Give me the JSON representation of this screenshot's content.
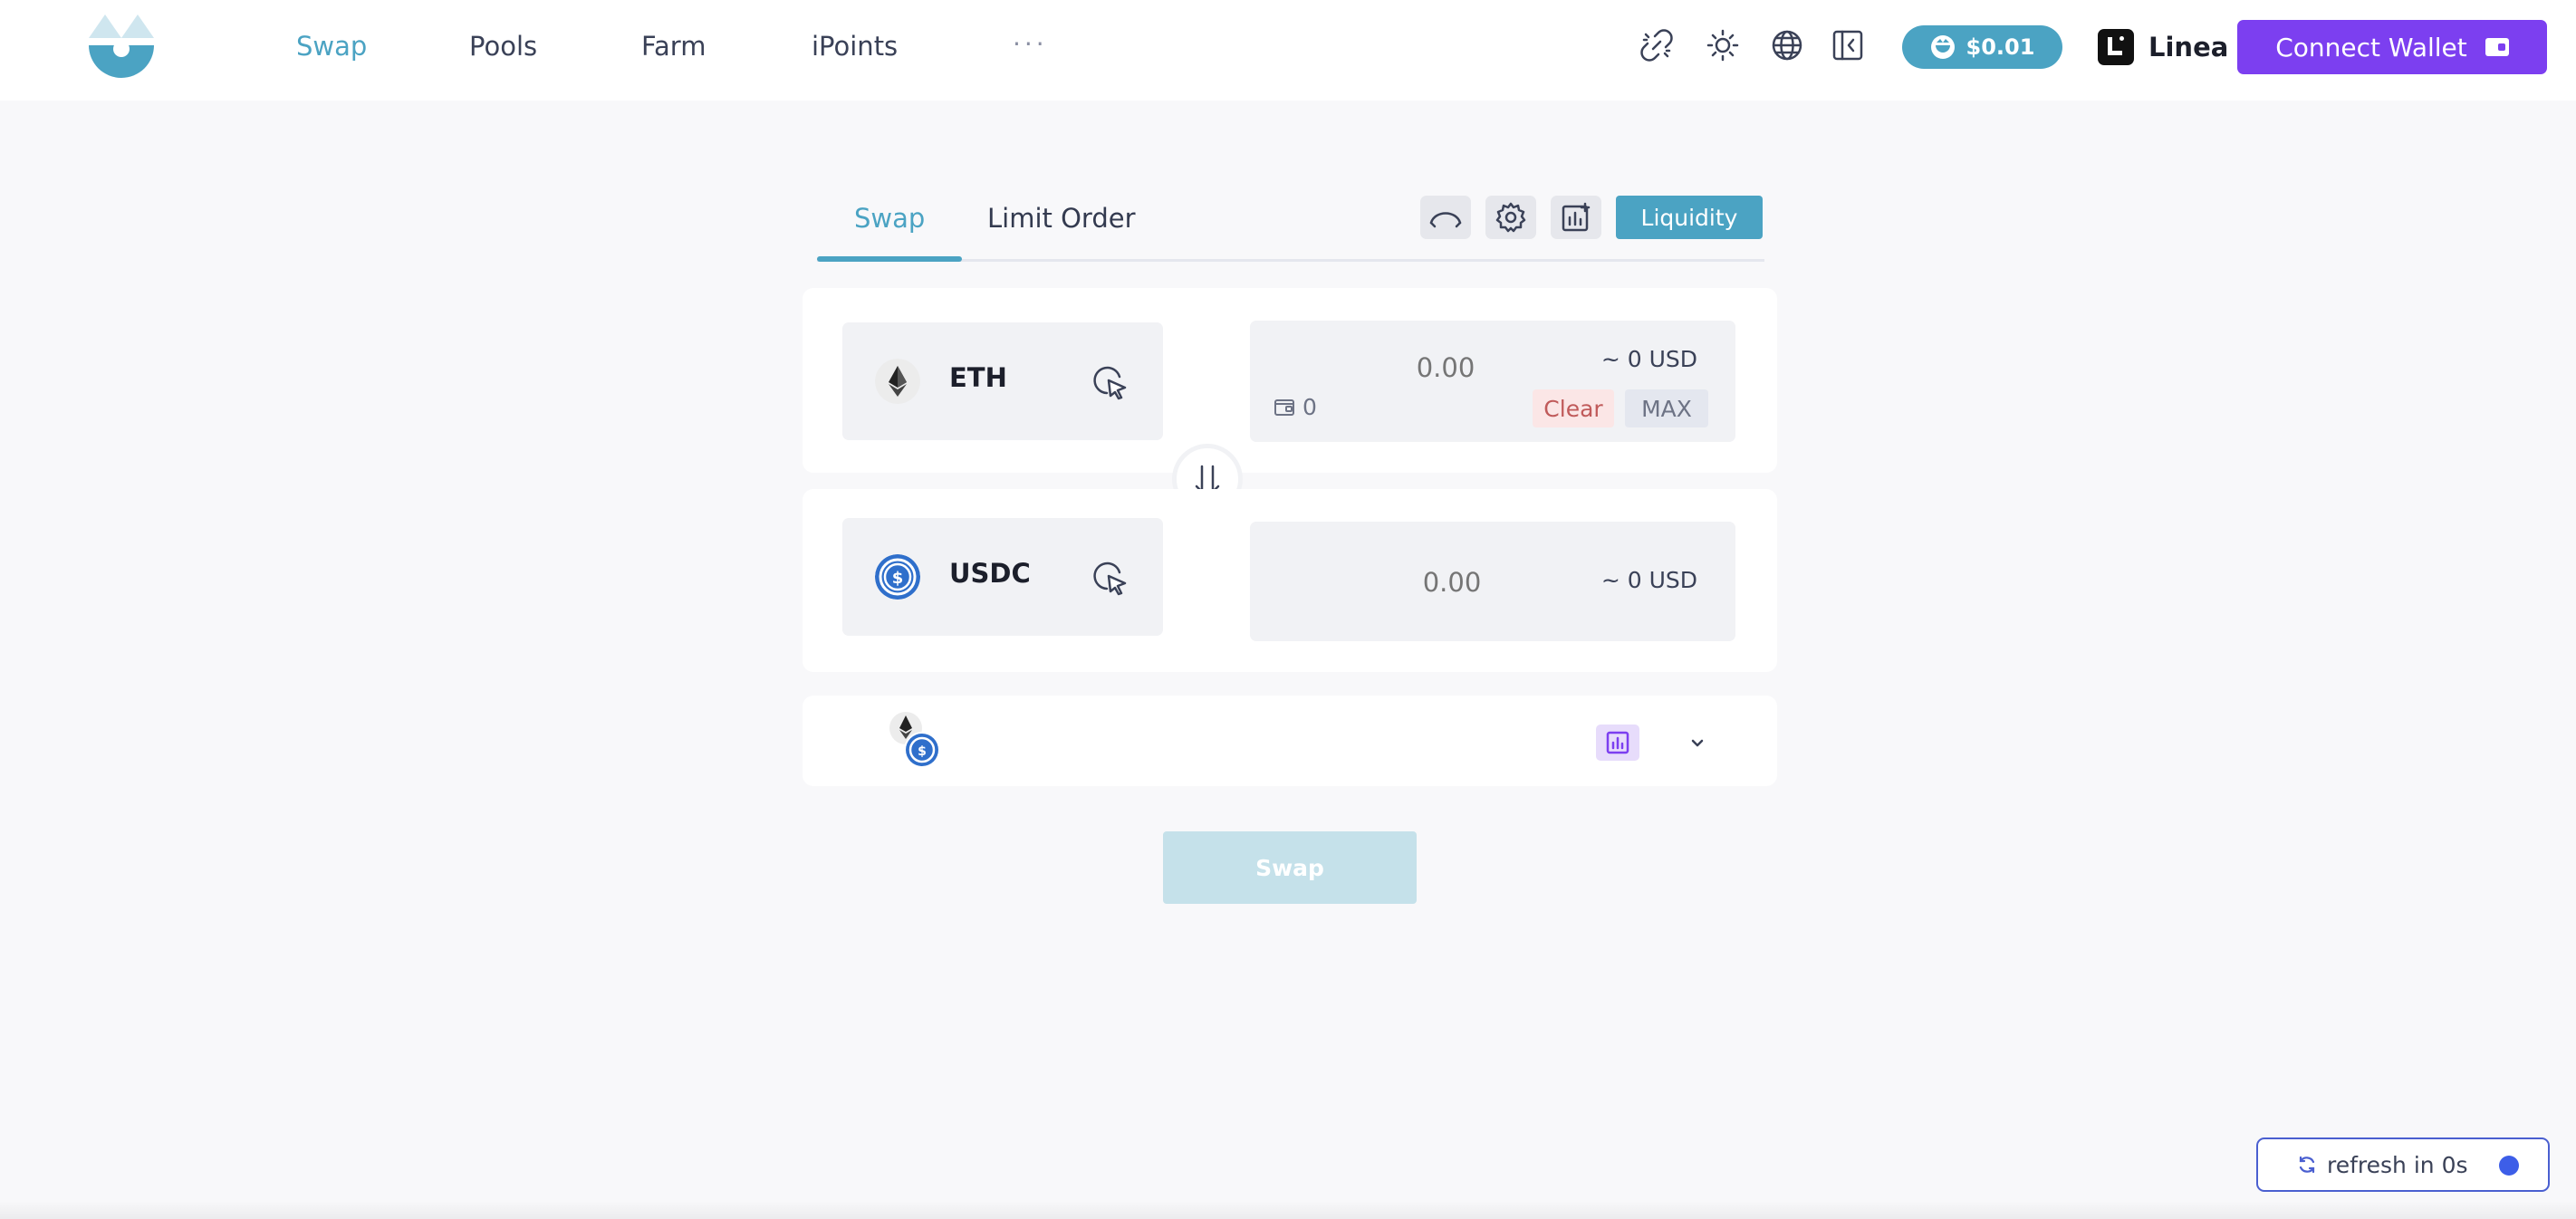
{
  "header": {
    "nav": [
      "Swap",
      "Pools",
      "Farm",
      "iPoints"
    ],
    "more": "···",
    "price": "$0.01",
    "network": "Linea",
    "connect_label": "Connect Wallet",
    "icons": [
      "unlink-icon",
      "sun-icon",
      "globe-icon",
      "sidebar-collapse-icon"
    ]
  },
  "swap": {
    "tabs": [
      "Swap",
      "Limit Order"
    ],
    "liquidity_label": "Liquidity",
    "from": {
      "symbol": "ETH",
      "amount": "0.00",
      "usd": "~ 0 USD",
      "balance": "0",
      "clear_label": "Clear",
      "max_label": "MAX"
    },
    "to": {
      "symbol": "USDC",
      "amount": "0.00",
      "usd": "~ 0 USD"
    },
    "swap_label": "Swap"
  },
  "refresh": {
    "label": "refresh in 0s"
  },
  "colors": {
    "accent": "#4ba3c3",
    "brand_purple": "#7c3ff0",
    "background": "#f8f8fa",
    "refresh_dot": "#3d5ee8"
  }
}
